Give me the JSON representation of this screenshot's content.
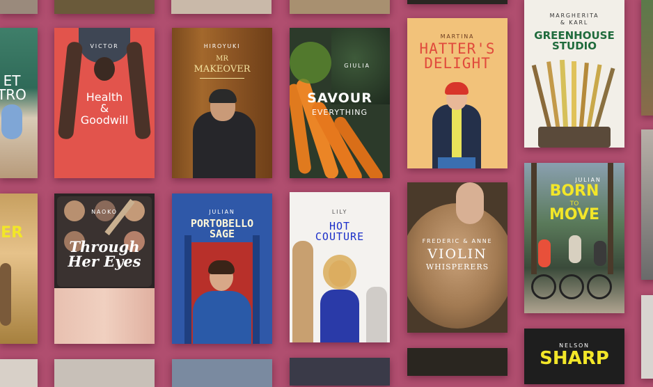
{
  "cards": {
    "edge_top": {
      "title": "ET\nTRO"
    },
    "edge_mid": {
      "title": "WER"
    },
    "victor": {
      "name": "VICTOR",
      "title": "Health\n&\nGoodwill"
    },
    "hiroyuki": {
      "name": "HIROYUKI",
      "title_small": "MR",
      "title": "MAKEOVER"
    },
    "giulia": {
      "name": "GIULIA",
      "title": "SAVOUR",
      "title2": "EVERYTHING"
    },
    "martina": {
      "name": "MARTINA",
      "title": "HATTER'S\nDELIGHT"
    },
    "greenhouse": {
      "name": "MARGHERITA\n& KARL",
      "title": "GREENHOUSE\nSTUDIO"
    },
    "naoko": {
      "name": "NAOKO",
      "title": "Through\nHer Eyes"
    },
    "julian1": {
      "name": "JULIAN",
      "title": "PORTOBELLO\nSAGE"
    },
    "lily": {
      "name": "LILY",
      "title": "HOT\nCOUTURE"
    },
    "violin": {
      "name": "FREDERIC & ANNE",
      "title": "VIOLIN",
      "title2": "WHISPERERS"
    },
    "julian2": {
      "name": "JULIAN",
      "title": "BORN",
      "title_small": "TO",
      "title2": "MOVE"
    },
    "nelson": {
      "name": "NELSON",
      "title": "SHARP"
    }
  },
  "colors": {
    "background": "#b04e6f",
    "victor_bg": "#e2544c",
    "martina_bg": "#f2c27a",
    "lily_title": "#1b2fc9",
    "martina_title": "#e04a3c",
    "greenhouse_title": "#1f6b3c",
    "julian2_title": "#f2e629"
  }
}
